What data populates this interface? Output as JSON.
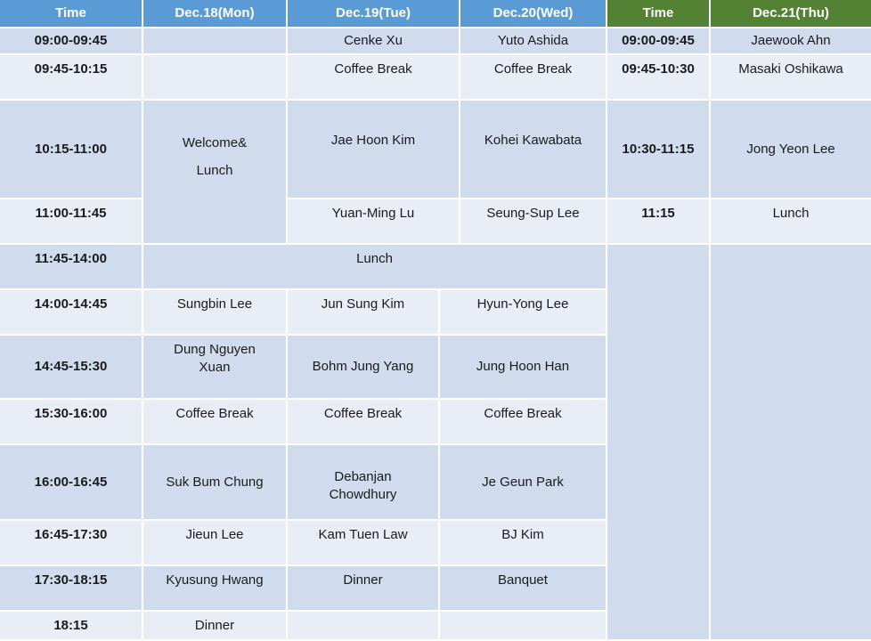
{
  "header": {
    "time": "Time",
    "dec18": "Dec.18(Mon)",
    "dec19": "Dec.19(Tue)",
    "dec20": "Dec.20(Wed)",
    "time2": "Time",
    "dec21": "Dec.21(Thu)"
  },
  "colors": {
    "header_blue": "#5b9bd5",
    "header_green": "#548235",
    "row_dark": "#d0dcee",
    "row_light": "#e9eef6"
  },
  "rows": {
    "r1": {
      "time": "09:00-09:45",
      "dec18": "",
      "dec19": "Cenke Xu",
      "dec20": "Yuto Ashida",
      "time2": "09:00-09:45",
      "dec21": "Jaewook Ahn"
    },
    "r2": {
      "time": "09:45-10:15",
      "dec18": "",
      "dec19": "Coffee Break",
      "dec20": "Coffee Break",
      "time2": "09:45-10:30",
      "dec21": "Masaki Oshikawa"
    },
    "r3": {
      "time": "10:15-11:00",
      "dec18": "Welcome&\nLunch",
      "dec19": "Jae Hoon Kim",
      "dec20": "Kohei Kawabata",
      "time2": "10:30-11:15",
      "dec21": "Jong Yeon Lee"
    },
    "r4": {
      "time": "11:00-11:45",
      "dec19": "Yuan-Ming Lu",
      "dec20": "Seung-Sup Lee",
      "time2": "11:15",
      "dec21": "Lunch"
    },
    "r5": {
      "time": "11:45-14:00",
      "merged": "Lunch"
    },
    "r6": {
      "time": "14:00-14:45",
      "dec18": "Sungbin Lee",
      "dec19": "Jun Sung Kim",
      "dec20": "Hyun-Yong Lee"
    },
    "r7": {
      "time": "14:45-15:30",
      "dec18": "Dung Nguyen\nXuan",
      "dec19": "Bohm Jung Yang",
      "dec20": "Jung Hoon Han"
    },
    "r8": {
      "time": "15:30-16:00",
      "dec18": "Coffee Break",
      "dec19": "Coffee Break",
      "dec20": "Coffee Break"
    },
    "r9": {
      "time": "16:00-16:45",
      "dec18": "Suk Bum Chung",
      "dec19": "Debanjan\nChowdhury",
      "dec20": "Je Geun Park"
    },
    "r10": {
      "time": "16:45-17:30",
      "dec18": "Jieun Lee",
      "dec19": "Kam Tuen Law",
      "dec20": "BJ Kim"
    },
    "r11": {
      "time": "17:30-18:15",
      "dec18": "Kyusung Hwang",
      "dec19": "Dinner",
      "dec20": "Banquet"
    },
    "r12": {
      "time": "18:15",
      "dec18": "Dinner",
      "dec19": "",
      "dec20": ""
    }
  }
}
